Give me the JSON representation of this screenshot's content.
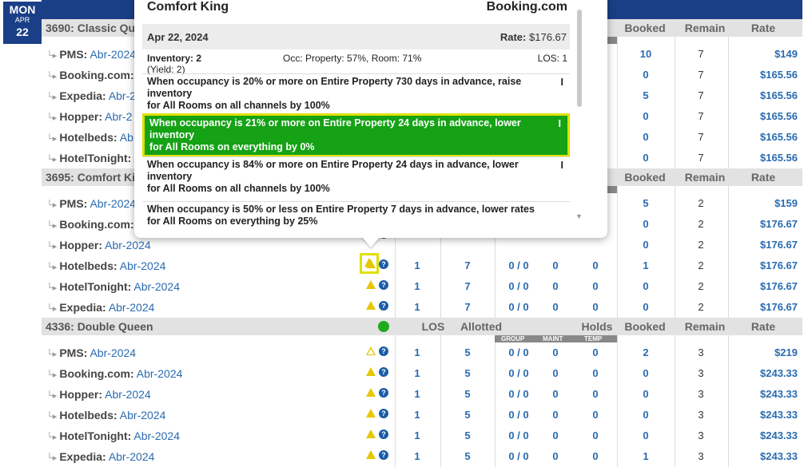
{
  "day": {
    "weekday": "MON",
    "month": "APR",
    "date": "22"
  },
  "headers": {
    "los": "LOS",
    "allotted": "Allotted",
    "holds": "Holds",
    "booked": "Booked",
    "remain": "Remain",
    "rate": "Rate",
    "group": "GROUP",
    "maint": "MAINT",
    "temp": "TEMP"
  },
  "sections": [
    {
      "title": "3690: Classic Qu",
      "rows": [
        {
          "ch": "PMS:",
          "mo": "Abr-2024",
          "booked": "10",
          "remain": "7",
          "rate": "$149"
        },
        {
          "ch": "Booking.com:",
          "mo": "A",
          "booked": "0",
          "remain": "7",
          "rate": "$165.56"
        },
        {
          "ch": "Expedia:",
          "mo": "Abr-2",
          "booked": "5",
          "remain": "7",
          "rate": "$165.56"
        },
        {
          "ch": "Hopper:",
          "mo": "Abr-2",
          "booked": "0",
          "remain": "7",
          "rate": "$165.56"
        },
        {
          "ch": "Hotelbeds:",
          "mo": "Ab",
          "booked": "0",
          "remain": "7",
          "rate": "$165.56"
        },
        {
          "ch": "HotelTonight:",
          "mo": "A",
          "booked": "0",
          "remain": "7",
          "rate": "$165.56"
        }
      ]
    },
    {
      "title": "3695: Comfort Ki",
      "rows": [
        {
          "ch": "PMS:",
          "mo": "Abr-2024",
          "booked": "5",
          "remain": "2",
          "rate": "$159"
        },
        {
          "ch": "Booking.com:",
          "mo": "",
          "booked": "0",
          "remain": "2",
          "rate": "$176.67"
        },
        {
          "ch": "Hopper:",
          "mo": "Abr-2024",
          "los": "",
          "allot": "",
          "hold": "",
          "maint": "",
          "temp": "",
          "booked": "0",
          "remain": "2",
          "rate": "$176.67"
        },
        {
          "ch": "Hotelbeds:",
          "mo": "Abr-2024",
          "los": "1",
          "allot": "7",
          "hold": "0 / 0",
          "maint": "0",
          "temp": "0",
          "booked": "1",
          "remain": "2",
          "rate": "$176.67"
        },
        {
          "ch": "HotelTonight:",
          "mo": "Abr-2024",
          "los": "1",
          "allot": "7",
          "hold": "0 / 0",
          "maint": "0",
          "temp": "0",
          "booked": "0",
          "remain": "2",
          "rate": "$176.67"
        },
        {
          "ch": "Expedia:",
          "mo": "Abr-2024",
          "los": "1",
          "allot": "7",
          "hold": "0 / 0",
          "maint": "0",
          "temp": "0",
          "booked": "0",
          "remain": "2",
          "rate": "$176.67"
        }
      ]
    },
    {
      "title": "4336: Double Queen",
      "rows": [
        {
          "ch": "PMS:",
          "mo": "Abr-2024",
          "los": "1",
          "allot": "5",
          "hold": "0 / 0",
          "maint": "0",
          "temp": "0",
          "booked": "2",
          "remain": "3",
          "rate": "$219"
        },
        {
          "ch": "Booking.com:",
          "mo": "Abr-2024",
          "los": "1",
          "allot": "5",
          "hold": "0 / 0",
          "maint": "0",
          "temp": "0",
          "booked": "0",
          "remain": "3",
          "rate": "$243.33"
        },
        {
          "ch": "Hopper:",
          "mo": "Abr-2024",
          "los": "1",
          "allot": "5",
          "hold": "0 / 0",
          "maint": "0",
          "temp": "0",
          "booked": "0",
          "remain": "3",
          "rate": "$243.33"
        },
        {
          "ch": "Hotelbeds:",
          "mo": "Abr-2024",
          "los": "1",
          "allot": "5",
          "hold": "0 / 0",
          "maint": "0",
          "temp": "0",
          "booked": "0",
          "remain": "3",
          "rate": "$243.33"
        },
        {
          "ch": "HotelTonight:",
          "mo": "Abr-2024",
          "los": "1",
          "allot": "5",
          "hold": "0 / 0",
          "maint": "0",
          "temp": "0",
          "booked": "0",
          "remain": "3",
          "rate": "$243.33"
        },
        {
          "ch": "Expedia:",
          "mo": "Abr-2024",
          "los": "1",
          "allot": "5",
          "hold": "0 / 0",
          "maint": "0",
          "temp": "0",
          "booked": "1",
          "remain": "3",
          "rate": "$243.33"
        }
      ]
    }
  ],
  "popup": {
    "title": "Comfort King",
    "channel": "Booking.com",
    "date": "Apr 22, 2024",
    "rate_label": "Rate:",
    "rate": "$176.67",
    "inventory": "Inventory: 2",
    "yield": "(Yield: 2)",
    "occ": "Occ: Property: 57%, Room: 71%",
    "los": "LOS: 1",
    "rules": [
      {
        "l1": "When occupancy is 20% or more on Entire Property 730 days in advance, raise",
        "l2": "inventory",
        "l3": "for All Rooms on all channels by 100%",
        "i": "I"
      },
      {
        "l1": "When occupancy is 21% or more on Entire Property 24 days in advance, lower",
        "l2": "inventory",
        "l3": "for All Rooms on everything by 0%",
        "i": "I"
      },
      {
        "l1": "When occupancy is 84% or more on Entire Property 24 days in advance, lower",
        "l2": "inventory",
        "l3": "for All Rooms on all channels by 100%",
        "i": "I"
      },
      {
        "l1": "When occupancy is 50% or less on Entire Property 7 days in advance, lower rates",
        "l2": "for All Rooms on everything by 25%",
        "l3": "",
        "i": ""
      }
    ]
  },
  "colors": {
    "header": "#1a3f87",
    "link": "#2a6bb0",
    "selected_rule": "#15a215",
    "highlight": "#e0e000",
    "warning": "#e6c700",
    "ok": "#1faa1f"
  }
}
